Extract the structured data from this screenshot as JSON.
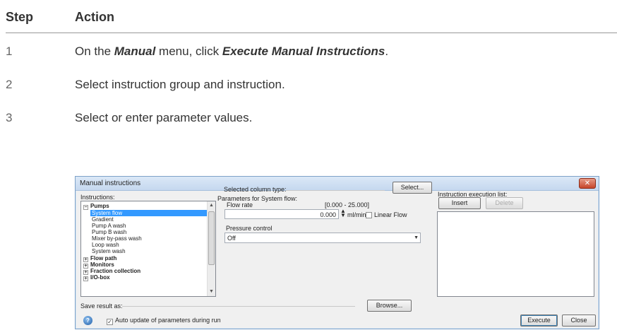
{
  "doc": {
    "col_step": "Step",
    "col_action": "Action",
    "steps": [
      {
        "num": "1",
        "pre": "On the ",
        "b1": "Manual",
        "mid": " menu, click ",
        "b2": "Execute Manual Instructions",
        "post": "."
      },
      {
        "num": "2",
        "text": "Select instruction group and instruction."
      },
      {
        "num": "3",
        "text": "Select or enter parameter values."
      }
    ]
  },
  "dialog": {
    "title": "Manual instructions",
    "instructions_label": "Instructions:",
    "tree": [
      {
        "label": "Pumps",
        "group": true,
        "expander": "−"
      },
      {
        "label": "System flow",
        "selected": true
      },
      {
        "label": "Gradient"
      },
      {
        "label": "Pump A wash"
      },
      {
        "label": "Pump B wash"
      },
      {
        "label": "Mixer by-pass wash"
      },
      {
        "label": "Loop wash"
      },
      {
        "label": "System wash"
      },
      {
        "label": "Flow path",
        "group": true,
        "expander": "+"
      },
      {
        "label": "Monitors",
        "group": true,
        "expander": "+"
      },
      {
        "label": "Fraction collection",
        "group": true,
        "expander": "+"
      },
      {
        "label": "I/O-box",
        "group": true,
        "expander": "+"
      }
    ],
    "selected_column_label": "Selected column type:",
    "select_button": "Select...",
    "params_for_label": "Parameters for System flow:",
    "flow_rate_label": "Flow rate",
    "flow_range": "[0.000 - 25.000]",
    "flow_value": "0.000",
    "flow_unit": "ml/min",
    "linear_flow_label": "Linear Flow",
    "pressure_label": "Pressure control",
    "pressure_value": "Off",
    "exec_list_label": "Instruction execution list:",
    "insert_button": "Insert",
    "delete_button": "Delete",
    "save_result_label": "Save result as:",
    "browse_button": "Browse...",
    "auto_update_label": "Auto update of parameters during run",
    "execute_button": "Execute",
    "close_button": "Close",
    "close_x": "✕",
    "help_glyph": "?"
  }
}
